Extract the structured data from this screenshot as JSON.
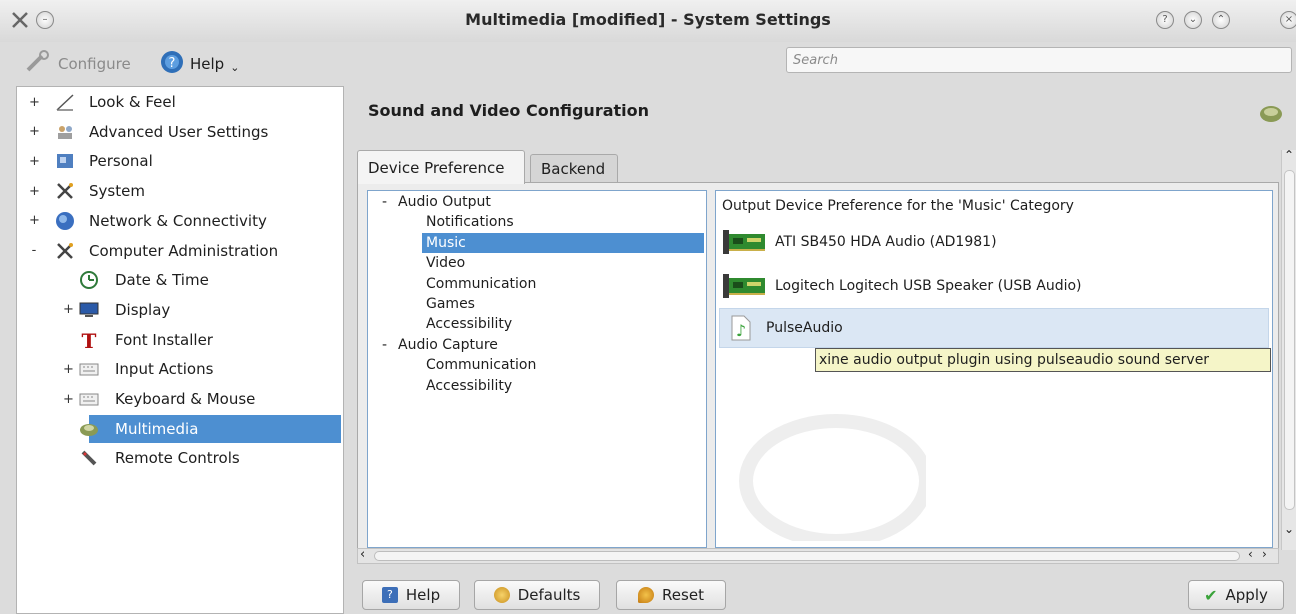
{
  "window": {
    "title": "Multimedia [modified] - System Settings"
  },
  "toolbar": {
    "configure_label": "Configure",
    "help_label": "Help",
    "search_placeholder": "Search"
  },
  "sidebar": {
    "items": [
      {
        "label": "Look & Feel",
        "expander": "+",
        "icon": "look-feel-icon"
      },
      {
        "label": "Advanced User Settings",
        "expander": "+",
        "icon": "users-icon"
      },
      {
        "label": "Personal",
        "expander": "+",
        "icon": "personal-icon"
      },
      {
        "label": "System",
        "expander": "+",
        "icon": "system-tools-icon"
      },
      {
        "label": "Network & Connectivity",
        "expander": "+",
        "icon": "globe-icon"
      },
      {
        "label": "Computer Administration",
        "expander": "-",
        "icon": "system-tools-icon"
      },
      {
        "label": "Date & Time",
        "expander": "",
        "icon": "clock-icon"
      },
      {
        "label": "Display",
        "expander": "+",
        "icon": "monitor-icon"
      },
      {
        "label": "Font Installer",
        "expander": "",
        "icon": "font-icon"
      },
      {
        "label": "Input Actions",
        "expander": "+",
        "icon": "keyboard-icon"
      },
      {
        "label": "Keyboard & Mouse",
        "expander": "+",
        "icon": "keyboard-icon"
      },
      {
        "label": "Multimedia",
        "expander": "",
        "icon": "multimedia-icon",
        "selected": true
      },
      {
        "label": "Remote Controls",
        "expander": "",
        "icon": "remote-icon"
      }
    ]
  },
  "main": {
    "title": "Sound and Video Configuration",
    "tabs": [
      {
        "label": "Device Preference",
        "active": true
      },
      {
        "label": "Backend",
        "active": false
      }
    ],
    "categories": [
      {
        "label": "Audio Output",
        "expander": "-"
      },
      {
        "label": "Notifications"
      },
      {
        "label": "Music",
        "selected": true
      },
      {
        "label": "Video"
      },
      {
        "label": "Communication"
      },
      {
        "label": "Games"
      },
      {
        "label": "Accessibility"
      },
      {
        "label": "Audio Capture",
        "expander": "-"
      },
      {
        "label": "Communication"
      },
      {
        "label": "Accessibility"
      }
    ],
    "device_header": "Output Device Preference for the 'Music' Category",
    "devices": [
      {
        "label": "ATI SB450 HDA Audio (AD1981)",
        "icon": "sound-card-icon"
      },
      {
        "label": "Logitech Logitech USB Speaker (USB Audio)",
        "icon": "sound-card-icon"
      },
      {
        "label": "PulseAudio",
        "icon": "audio-file-icon",
        "highlighted": true
      }
    ],
    "tooltip": "xine audio output plugin using pulseaudio sound server"
  },
  "buttons": {
    "help": "Help",
    "defaults": "Defaults",
    "reset": "Reset",
    "apply": "Apply"
  },
  "colors": {
    "selection": "#4d8fd1",
    "tooltip_bg": "#f5f5c8",
    "apply_check": "#3aa33a"
  }
}
